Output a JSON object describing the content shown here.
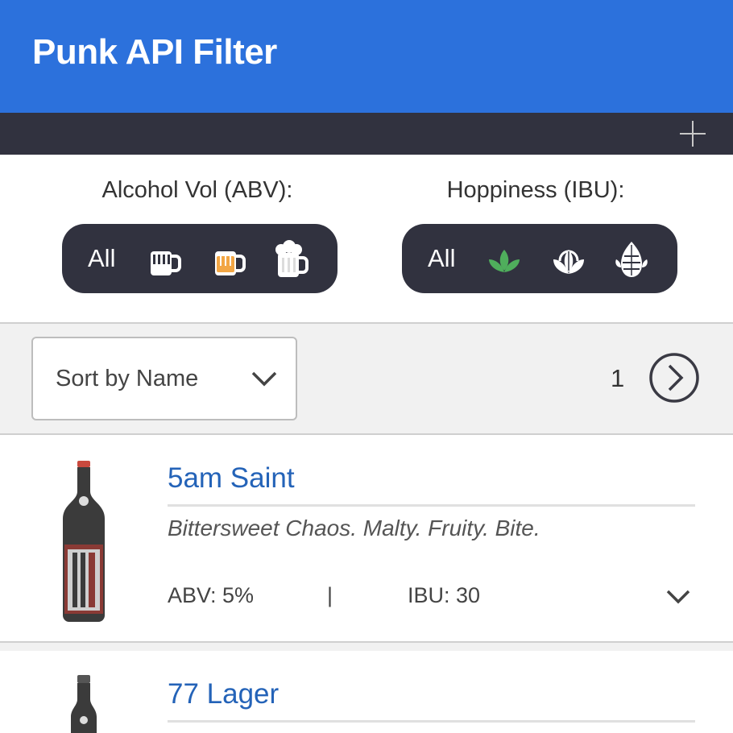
{
  "header": {
    "title": "Punk API Filter"
  },
  "toolbar": {
    "add_icon": "plus-icon"
  },
  "filters": {
    "abv": {
      "label": "Alcohol Vol (ABV):",
      "all_label": "All",
      "options": [
        "mug-low-icon",
        "mug-medium-icon",
        "mug-high-icon"
      ],
      "colors": {
        "low": "#ffffff",
        "medium": "#f2a644",
        "high": "#ffffff"
      }
    },
    "ibu": {
      "label": "Hoppiness (IBU):",
      "all_label": "All",
      "options": [
        "hop-low-icon",
        "hop-medium-icon",
        "hop-high-icon"
      ],
      "colors": {
        "low": "#4fae5c",
        "medium": "#ffffff",
        "high": "#ffffff"
      }
    }
  },
  "sort": {
    "selected": "Sort by Name"
  },
  "pagination": {
    "page": "1"
  },
  "beers": [
    {
      "name": "5am Saint",
      "tagline": "Bittersweet Chaos. Malty. Fruity. Bite.",
      "abv": "ABV: 5%",
      "separator": "|",
      "ibu": "IBU: 30"
    },
    {
      "name": "77 Lager"
    }
  ],
  "colors": {
    "header": "#2c71dc",
    "dark": "#31323f",
    "link": "#2463b8"
  }
}
